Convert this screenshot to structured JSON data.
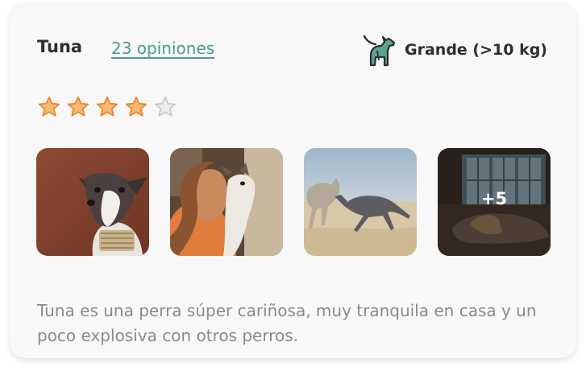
{
  "review": {
    "dog_name": "Tuna",
    "reviews_link": "23 opiniones",
    "size_label": "Grande (>10 kg)",
    "size_icon": "large-dog-icon",
    "rating": 4,
    "rating_max": 5,
    "star_filled_color": "#f2963c",
    "star_empty_color": "#c8c8c8",
    "link_color": "#4e9a8c",
    "photos": [
      {
        "name": "photo-greyhound-portrait"
      },
      {
        "name": "photo-greyhound-hug"
      },
      {
        "name": "photo-greyhounds-running"
      },
      {
        "name": "photo-greyhound-lying",
        "more_label": "+5"
      }
    ],
    "description": "Tuna es una perra súper cariñosa, muy tranquila en casa y un poco explosiva con otros perros."
  }
}
